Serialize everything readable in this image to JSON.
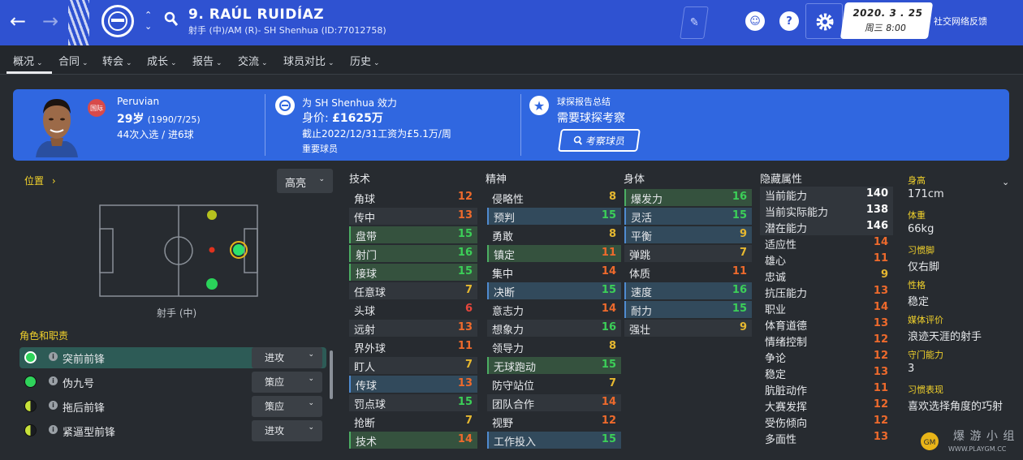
{
  "header": {
    "name": "9. RAÚL RUIDÍAZ",
    "subtitle": "射手 (中)/AM (R)- SH Shenhua (ID:77012758)",
    "date": "2020. 3 . 25",
    "day_time": "周三 8:00",
    "feedback": "社交网络反馈",
    "help_icon": "?"
  },
  "nav": [
    "概况",
    "合同",
    "转会",
    "成长",
    "报告",
    "交流",
    "球员对比",
    "历史"
  ],
  "banner": {
    "nationality": "Peruvian",
    "intl_badge": "国际",
    "age": "29岁",
    "dob": "(1990/7/25)",
    "caps": "44次入选 / 进6球",
    "club_line": "为 SH Shenhua 效力",
    "value_label": "身价: ",
    "value": "£1625万",
    "contract": "截止2022/12/31工资为£5.1万/周",
    "status": "重要球员",
    "scout_title": "球探报告总结",
    "scout_need": "需要球探考察",
    "scout_btn": "考察球员"
  },
  "position": {
    "link": "位置",
    "highlight": "高亮",
    "label": "射手 (中)"
  },
  "roles": {
    "title": "角色和职责",
    "items": [
      {
        "name": "突前前锋",
        "duty": "进攻",
        "color": "#2fd35b"
      },
      {
        "name": "伪九号",
        "duty": "策应",
        "color": "#2fd35b"
      },
      {
        "name": "拖后前锋",
        "duty": "策应",
        "color": "#c8e23a"
      },
      {
        "name": "紧逼型前锋",
        "duty": "进攻",
        "color": "#c8e23a"
      }
    ]
  },
  "attr_colors": {
    "high": "#3ccf58",
    "mid": "#e6b830",
    "low": "#ee6a2c",
    "vlow": "#e8463c"
  },
  "technical": {
    "title": "技术",
    "items": [
      {
        "n": "角球",
        "v": 12
      },
      {
        "n": "传中",
        "v": 13
      },
      {
        "n": "盘带",
        "v": 15,
        "h": "g"
      },
      {
        "n": "射门",
        "v": 16,
        "h": "g"
      },
      {
        "n": "接球",
        "v": 15,
        "h": "g"
      },
      {
        "n": "任意球",
        "v": 7
      },
      {
        "n": "头球",
        "v": 6
      },
      {
        "n": "远射",
        "v": 13
      },
      {
        "n": "界外球",
        "v": 11
      },
      {
        "n": "盯人",
        "v": 7
      },
      {
        "n": "传球",
        "v": 13,
        "h": "b"
      },
      {
        "n": "罚点球",
        "v": 15
      },
      {
        "n": "抢断",
        "v": 7
      },
      {
        "n": "技术",
        "v": 14,
        "h": "g"
      }
    ]
  },
  "mental": {
    "title": "精神",
    "items": [
      {
        "n": "侵略性",
        "v": 8
      },
      {
        "n": "预判",
        "v": 15,
        "h": "b"
      },
      {
        "n": "勇敢",
        "v": 8
      },
      {
        "n": "镇定",
        "v": 11,
        "h": "g"
      },
      {
        "n": "集中",
        "v": 14
      },
      {
        "n": "决断",
        "v": 15,
        "h": "b"
      },
      {
        "n": "意志力",
        "v": 14
      },
      {
        "n": "想象力",
        "v": 16
      },
      {
        "n": "领导力",
        "v": 8
      },
      {
        "n": "无球跑动",
        "v": 15,
        "h": "g"
      },
      {
        "n": "防守站位",
        "v": 7
      },
      {
        "n": "团队合作",
        "v": 14
      },
      {
        "n": "视野",
        "v": 12
      },
      {
        "n": "工作投入",
        "v": 15,
        "h": "b"
      }
    ]
  },
  "physical": {
    "title": "身体",
    "items": [
      {
        "n": "爆发力",
        "v": 16,
        "h": "g"
      },
      {
        "n": "灵活",
        "v": 15,
        "h": "b"
      },
      {
        "n": "平衡",
        "v": 9,
        "h": "b"
      },
      {
        "n": "弹跳",
        "v": 7
      },
      {
        "n": "体质",
        "v": 11
      },
      {
        "n": "速度",
        "v": 16,
        "h": "b"
      },
      {
        "n": "耐力",
        "v": 15,
        "h": "b"
      },
      {
        "n": "强壮",
        "v": 9
      }
    ]
  },
  "hidden": {
    "title": "隐藏属性",
    "items": [
      {
        "n": "当前能力",
        "v": "140"
      },
      {
        "n": "当前实际能力",
        "v": "138"
      },
      {
        "n": "潜在能力",
        "v": "146"
      },
      {
        "n": "适应性",
        "v": "14"
      },
      {
        "n": "雄心",
        "v": "11"
      },
      {
        "n": "忠诚",
        "v": "9"
      },
      {
        "n": "抗压能力",
        "v": "13"
      },
      {
        "n": "职业",
        "v": "14"
      },
      {
        "n": "体育道德",
        "v": "13"
      },
      {
        "n": "情绪控制",
        "v": "12"
      },
      {
        "n": "争论",
        "v": "12"
      },
      {
        "n": "稳定",
        "v": "13"
      },
      {
        "n": "肮脏动作",
        "v": "11"
      },
      {
        "n": "大赛发挥",
        "v": "12"
      },
      {
        "n": "受伤倾向",
        "v": "12"
      },
      {
        "n": "多面性",
        "v": "13"
      }
    ]
  },
  "info": [
    {
      "l": "身高",
      "v": "171cm"
    },
    {
      "l": "体重",
      "v": "66kg"
    },
    {
      "l": "习惯脚",
      "v": "仅右脚"
    },
    {
      "l": "性格",
      "v": "稳定"
    },
    {
      "l": "媒体评价",
      "v": "浪迹天涯的射手"
    },
    {
      "l": "守门能力",
      "v": "3"
    },
    {
      "l": "习惯表现",
      "v": "喜欢选择角度的巧射"
    }
  ],
  "watermark": {
    "cn": "爆 游 小 组",
    "url": "WWW.PLAYGM.CC"
  }
}
